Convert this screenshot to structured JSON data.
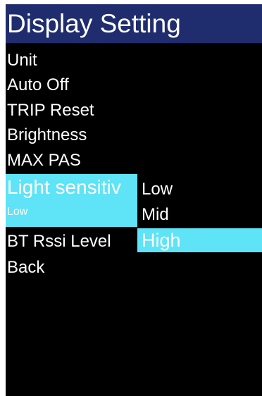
{
  "title": "Display Setting",
  "menu": {
    "unit": "Unit",
    "auto_off": "Auto Off",
    "trip_reset": "TRIP Reset",
    "brightness": "Brightness",
    "max_pas": "MAX PAS",
    "light_sensitivity": "Light sensitiv",
    "light_sensitivity_value": "Low",
    "bt_rssi_level": "BT Rssi Level",
    "back": "Back"
  },
  "submenu": {
    "options": [
      "Low",
      "Mid",
      "High"
    ],
    "selected": "High"
  },
  "colors": {
    "title_bar": "#1f2d6e",
    "highlight": "#5ee3f7",
    "background": "#000000",
    "text": "#ffffff"
  }
}
